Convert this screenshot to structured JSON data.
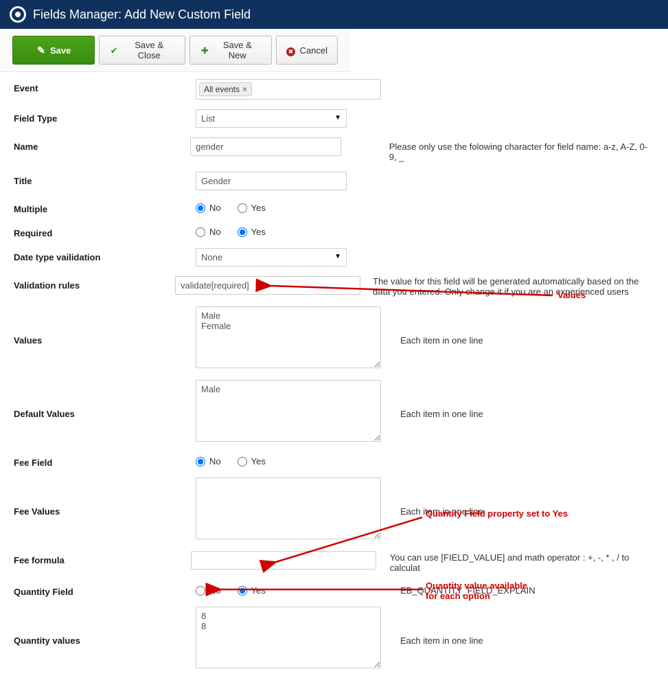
{
  "header": {
    "title": "Fields Manager: Add New Custom Field"
  },
  "toolbar": {
    "save": "Save",
    "save_close": "Save & Close",
    "save_new": "Save & New",
    "cancel": "Cancel"
  },
  "labels": {
    "event": "Event",
    "field_type": "Field Type",
    "name": "Name",
    "title": "Title",
    "multiple": "Multiple",
    "required": "Required",
    "date_validation": "Date type vailidation",
    "validation_rules": "Validation rules",
    "values": "Values",
    "default_values": "Default Values",
    "fee_field": "Fee Field",
    "fee_values": "Fee Values",
    "fee_formula": "Fee formula",
    "quantity_field": "Quantity Field",
    "quantity_values": "Quantity values"
  },
  "fields": {
    "event_tag": "All events",
    "field_type": "List",
    "name": "gender",
    "title": "Gender",
    "multiple": "No",
    "required": "Yes",
    "date_validation": "None",
    "validation_rules": "validate[required]",
    "values": "Male\nFemale",
    "default_values": "Male",
    "fee_field": "No",
    "fee_values": "",
    "fee_formula": "",
    "quantity_field": "Yes",
    "quantity_values": "8\n8"
  },
  "options": {
    "no": "No",
    "yes": "Yes"
  },
  "hints": {
    "name": "Please only use the folowing character for field name: a-z, A-Z, 0-9, _",
    "validation_rules": "The value for this field will be generated automatically based on the data you entered. Only change it if you are an experienced users",
    "values": "Each item in one line",
    "default_values": "Each item in one line",
    "fee_values": "Each item in one line",
    "fee_formula": "You can use [FIELD_VALUE] and math operator : +, -, * , / to calculat",
    "quantity_field": "EB_QUANTITY_FIELD_EXPLAIN",
    "quantity_values": "Each item in one line"
  },
  "annotations": {
    "values": "Values",
    "quantity_field": "Quantity Field property set to Yes",
    "quantity_values": "Quantity value available\nfor each option"
  }
}
